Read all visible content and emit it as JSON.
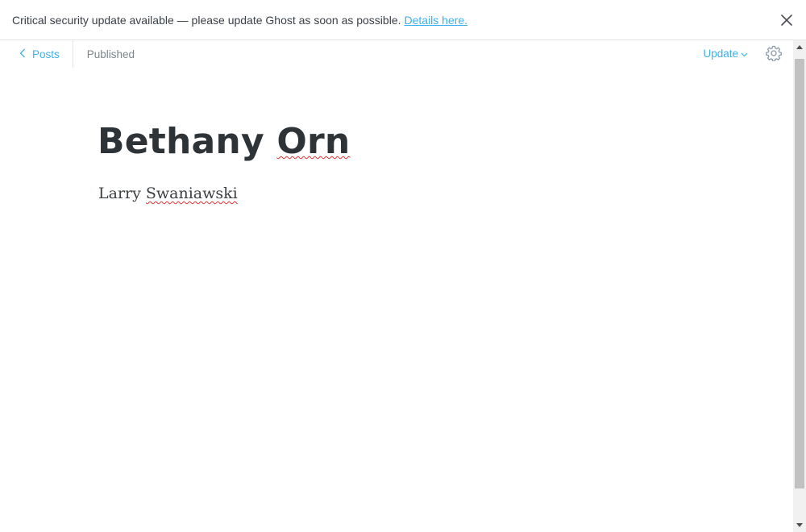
{
  "alert": {
    "message": "Critical security update available — please update Ghost as soon as possible.",
    "link_text": "Details here."
  },
  "header": {
    "back_label": "Posts",
    "status": "Published",
    "update_label": "Update"
  },
  "post": {
    "title_first": "Bethany ",
    "title_misspelled": "Orn",
    "body_first": "Larry ",
    "body_misspelled": "Swaniawski"
  },
  "icons": {
    "close": "close-icon",
    "back": "chevron-left-icon",
    "dropdown": "chevron-down-icon",
    "settings": "gear-icon",
    "scroll_up": "arrow-up-icon",
    "scroll_down": "arrow-down-icon"
  },
  "colors": {
    "accent": "#3eb0ef",
    "text": "#2e3338",
    "muted": "#7d878a",
    "spellcheck": "#e0322f"
  }
}
